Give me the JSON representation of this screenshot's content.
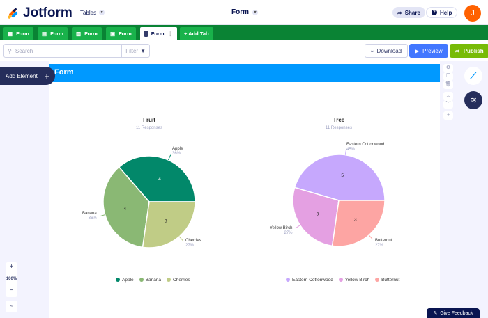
{
  "header": {
    "brand": "Jotform",
    "tables_label": "Tables",
    "title": "Form",
    "share_label": "Share",
    "help_label": "Help",
    "avatar_initial": "J"
  },
  "tabs": [
    {
      "label": "Form",
      "icon": "grid-icon"
    },
    {
      "label": "Form",
      "icon": "calendar-icon"
    },
    {
      "label": "Form",
      "icon": "columns-icon"
    },
    {
      "label": "Form",
      "icon": "upload-icon"
    },
    {
      "label": "Form",
      "icon": "chart-icon",
      "active": true
    }
  ],
  "add_tab_label": "+ Add Tab",
  "toolbar": {
    "search_placeholder": "Search",
    "filter_label": "Filter",
    "download_label": "Download",
    "preview_label": "Preview",
    "publish_label": "Publish"
  },
  "left": {
    "add_element_label": "Add Element",
    "zoom": "100%"
  },
  "form_title": "Form",
  "feedback_label": "Give Feedback",
  "chart_data": [
    {
      "type": "pie",
      "title": "Fruit",
      "subtitle": "11 Responses",
      "categories": [
        "Apple",
        "Banana",
        "Cherries"
      ],
      "values": [
        4,
        4,
        3
      ],
      "percents": [
        "36%",
        "36%",
        "27%"
      ],
      "colors": [
        "#02886a",
        "#8ab874",
        "#c0cc86"
      ]
    },
    {
      "type": "pie",
      "title": "Tree",
      "subtitle": "11 Responses",
      "categories": [
        "Eastern Cottonwood",
        "Yellow Birch",
        "Butternut"
      ],
      "values": [
        5,
        3,
        3
      ],
      "percents": [
        "45%",
        "27%",
        "27%"
      ],
      "colors": [
        "#c6a8fd",
        "#e4a0e2",
        "#fda5a3"
      ]
    }
  ]
}
